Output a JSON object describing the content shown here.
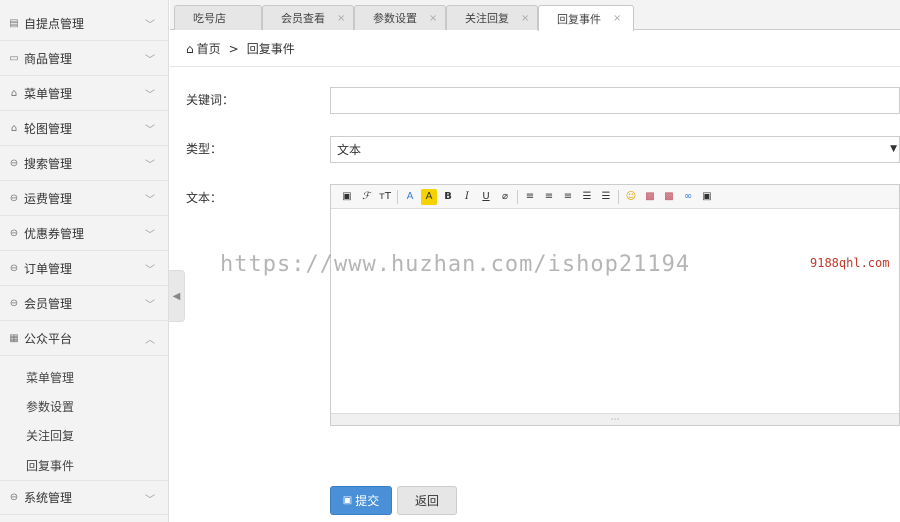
{
  "sidebar": {
    "items": [
      {
        "label": "自提点管理",
        "icon": "store-icon",
        "glyph": "▤",
        "chev": "﹀"
      },
      {
        "label": "商品管理",
        "icon": "card-icon",
        "glyph": "▭",
        "chev": "﹀"
      },
      {
        "label": "菜单管理",
        "icon": "bag-icon",
        "glyph": "⌂",
        "chev": "﹀"
      },
      {
        "label": "轮图管理",
        "icon": "bag-icon",
        "glyph": "⌂",
        "chev": "﹀"
      },
      {
        "label": "搜索管理",
        "icon": "circle-icon",
        "glyph": "⊖",
        "chev": "﹀"
      },
      {
        "label": "运费管理",
        "icon": "circle-icon",
        "glyph": "⊖",
        "chev": "﹀"
      },
      {
        "label": "优惠券管理",
        "icon": "circle-icon",
        "glyph": "⊖",
        "chev": "﹀"
      },
      {
        "label": "订单管理",
        "icon": "circle-icon",
        "glyph": "⊖",
        "chev": "﹀"
      },
      {
        "label": "会员管理",
        "icon": "circle-icon",
        "glyph": "⊖",
        "chev": "﹀"
      },
      {
        "label": "公众平台",
        "icon": "grid-icon",
        "glyph": "▦",
        "chev": "︿"
      },
      {
        "label": "系统管理",
        "icon": "circle-icon",
        "glyph": "⊖",
        "chev": "﹀"
      }
    ],
    "sub_items": [
      "菜单管理",
      "参数设置",
      "关注回复",
      "回复事件"
    ],
    "collapse_glyph": "◀"
  },
  "tabs": [
    {
      "label": "吃号店",
      "close": ""
    },
    {
      "label": "会员查看",
      "close": "×"
    },
    {
      "label": "参数设置",
      "close": "×"
    },
    {
      "label": "关注回复",
      "close": "×"
    },
    {
      "label": "回复事件",
      "close": "×"
    }
  ],
  "breadcrumb": {
    "home_glyph": "⌂",
    "home": "首页",
    "sep": ">",
    "current": "回复事件"
  },
  "form": {
    "keyword_label": "关键词：",
    "keyword_value": "",
    "type_label": "类型：",
    "type_value": "文本",
    "type_caret": "▼",
    "text_label": "文本："
  },
  "editor": {
    "toolbar": [
      "▣",
      "ℱ",
      "ᴛT",
      "A",
      "A",
      "B",
      "I",
      "U",
      "⌀",
      "≡",
      "≡",
      "≡",
      "☰",
      "☰",
      "☺",
      "▩",
      "▩",
      "∞",
      "▣"
    ],
    "resize_glyph": "⋯"
  },
  "buttons": {
    "submit": "提交",
    "submit_icon": "▣",
    "back": "返回"
  },
  "watermark": {
    "main": "https://www.huzhan.com/ishop21194",
    "side": "9188qhl.com"
  }
}
